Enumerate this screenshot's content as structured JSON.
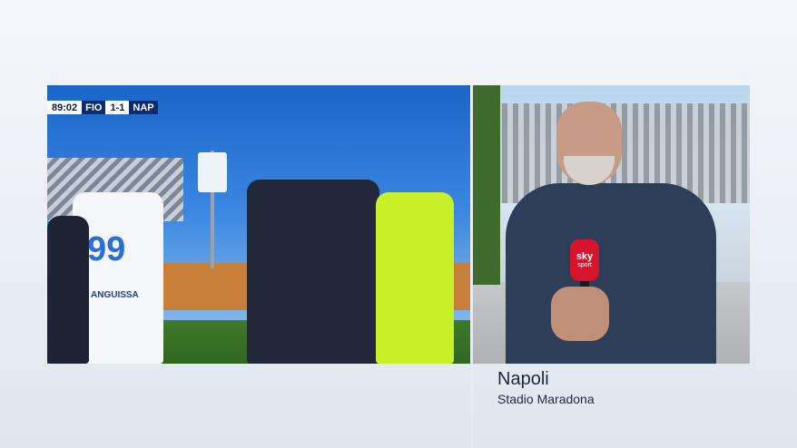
{
  "scoreboard": {
    "clock": "89:02",
    "home_team": "FIO",
    "score": "1-1",
    "away_team": "NAP"
  },
  "left_feed": {
    "player_number": "99",
    "player_name_on_shirt": "ANGUISSA"
  },
  "right_feed": {
    "mic_brand": "sky",
    "mic_sub": "sport"
  },
  "caption": {
    "location_title": "Napoli",
    "location_subtitle": "Stadio Maradona"
  },
  "colors": {
    "scoreboard_navy": "#0d2a6b",
    "sky_red": "#d8132c",
    "referee_shirt": "#c8f02a"
  }
}
